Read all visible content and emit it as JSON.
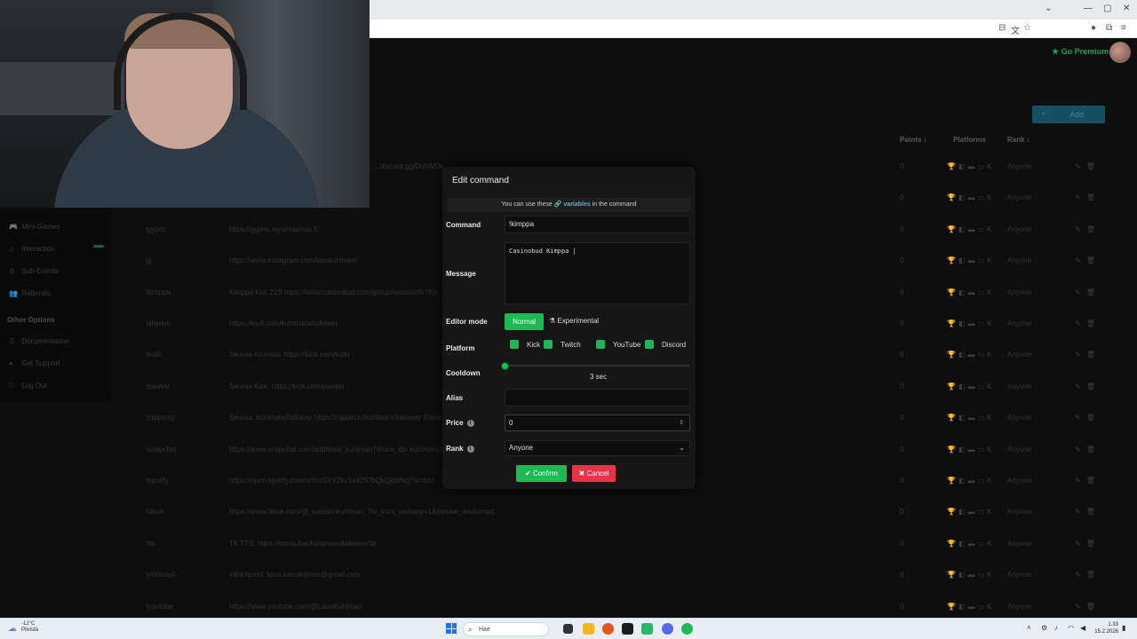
{
  "browser": {
    "window_controls": [
      "—",
      "▢",
      "✕"
    ],
    "chevron": "⌄",
    "toolbar_icons": [
      "tab-search-icon",
      "translate-icon",
      "star-icon",
      "profile-icon",
      "extensions-icon",
      "menu-icon"
    ]
  },
  "app": {
    "premium_label": "Go Premium",
    "add_button": {
      "icon": "+",
      "label": "Add"
    },
    "table": {
      "headers": {
        "points": "Points ↕",
        "platforms": "Platforms",
        "rank": "Rank ↕"
      },
      "rows": [
        {
          "name": "",
          "message": "…discord.gg/DuhWDb…",
          "points": "0",
          "rank": "Anyone"
        },
        {
          "name": "",
          "message": "",
          "points": "0",
          "rank": "Anyone"
        },
        {
          "name": "tgypm",
          "message": "https://gypmi.mysimashop.fi/",
          "points": "0",
          "rank": "Anyone"
        },
        {
          "name": "ig",
          "message": "https://www.instagram.com/lasskuhlmen/",
          "points": "0",
          "rank": "Anyone"
        },
        {
          "name": "!kimppa",
          "message": "Kimppa Klo: 21S https://www.casinobud.com/group/session/5r7Kh",
          "points": "0",
          "rank": "Anyone"
        },
        {
          "name": "!ahjelus",
          "message": "https://ko-fi.com/kuhlmanvitallower",
          "points": "0",
          "rank": "Anyone"
        },
        {
          "name": "!kulki",
          "message": "Seuraa Kickissä: https://kick.com/kulki",
          "points": "0",
          "rank": "Anyone"
        },
        {
          "name": "!pwekki",
          "message": "Seuraa Kick: https://kick.com/pwekki",
          "points": "0",
          "rank": "Anyone"
        },
        {
          "name": "!rappiony",
          "message": "Seuraa: kuhlmanvitallower https://rappio.tv/kuhlmanvitallower Rappio",
          "points": "0",
          "rank": "Anyone"
        },
        {
          "name": "!snapchat",
          "message": "https://www.snapchat.com/add/lassi_kuhlman?share_id= kuhlmanj/lassi",
          "points": "0",
          "rank": "Anyone"
        },
        {
          "name": "!spotify",
          "message": "https://open.spotify.com/artist/0XY2ku1u4267bQkQjb9Ncj?si=bzc",
          "points": "0",
          "rank": "Anyone"
        },
        {
          "name": "!tiktok",
          "message": "https://www.tiktok.com/@_kasukinkuhlman_?is_from_webapp=1&sender_device=pc",
          "points": "0",
          "rank": "Anyone"
        },
        {
          "name": "!tts",
          "message": "TK TTS: https://tomis.live/kuhlmanvitallower/tip",
          "points": "0",
          "rank": "Anyone"
        },
        {
          "name": "!yhteistyö",
          "message": "sähköposti: lassi.kasulkilmen@gmail.com",
          "points": "0",
          "rank": "Anyone"
        },
        {
          "name": "!youtube",
          "message": "https://www.youtube.com/@LassiKuhlman",
          "points": "0",
          "rank": "Anyone"
        }
      ]
    },
    "sidebar": {
      "items": [
        {
          "icon": "🎮",
          "label": "Mini-Games"
        },
        {
          "icon": "♫",
          "label": "Interaction"
        },
        {
          "icon": "⚙",
          "label": "Sub-Events"
        },
        {
          "icon": "👥",
          "label": "Referrals"
        }
      ],
      "other_heading": "Other Options",
      "other_items": [
        {
          "icon": "☰",
          "label": "Documentation"
        },
        {
          "icon": "●",
          "label": "Get Support"
        },
        {
          "icon": "⎋",
          "label": "Log Out"
        }
      ]
    }
  },
  "modal": {
    "title": "Edit command",
    "note_prefix": "You can use these",
    "note_link": "🔗 variables",
    "note_suffix": "in the command",
    "command_label": "Command",
    "command_value": "!kimppa",
    "message_label": "Message",
    "message_value": "Casinobud Kimppa |",
    "editor_mode_label": "Editor mode",
    "mode_normal": "Normal",
    "mode_experimental": "⚗ Experimental",
    "platform_label": "Platform",
    "platforms": [
      "Kick",
      "Twitch",
      "YouTube",
      "Discord"
    ],
    "cooldown_label": "Cooldown",
    "cooldown_value": "3 sec",
    "alias_label": "Alias",
    "alias_value": "",
    "price_label": "Price",
    "price_value": "0",
    "price_stepper": "⇕",
    "rank_label": "Rank",
    "rank_value": "Anyone",
    "info_glyph": "i",
    "confirm_label": "✔ Confirm",
    "cancel_label": "✖ Cancel"
  },
  "taskbar": {
    "weather_temp": "-12°C",
    "weather_desc": "Pilvistä",
    "search_placeholder": "Hae",
    "time": "1.33",
    "date": "15.2.2026"
  },
  "colors": {
    "accent_green": "#1db954",
    "cancel_red": "#e8324a",
    "link_blue": "#4fb3e8"
  }
}
